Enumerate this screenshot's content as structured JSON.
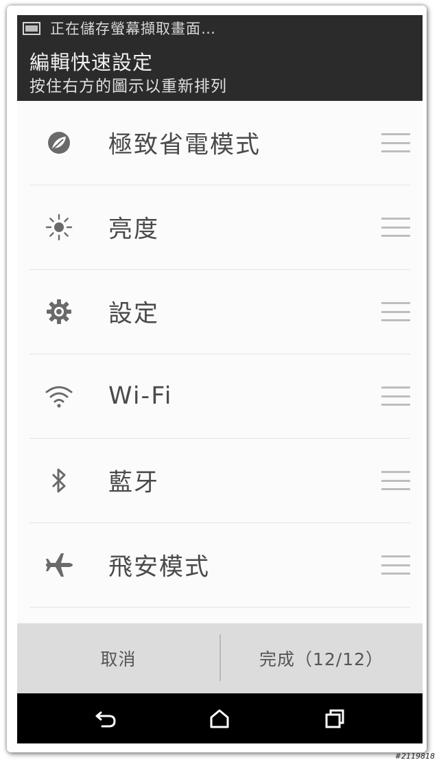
{
  "notification": {
    "text": "正在儲存螢幕擷取畫面…",
    "icon": "screenshot-icon"
  },
  "header": {
    "title": "編輯快速設定",
    "subtitle": "按住右方的圖示以重新排列"
  },
  "list": {
    "items": [
      {
        "label": "極致省電模式",
        "icon": "leaf-icon"
      },
      {
        "label": "亮度",
        "icon": "brightness-icon"
      },
      {
        "label": "設定",
        "icon": "gear-icon"
      },
      {
        "label": "Wi-Fi",
        "icon": "wifi-icon"
      },
      {
        "label": "藍牙",
        "icon": "bluetooth-icon"
      },
      {
        "label": "飛安模式",
        "icon": "airplane-icon"
      }
    ]
  },
  "actions": {
    "cancel_label": "取消",
    "done_label": "完成（12/12）"
  },
  "navbar": {
    "back_icon": "back-icon",
    "home_icon": "home-icon",
    "recents_icon": "recents-icon"
  },
  "watermark": "#2119818",
  "colors": {
    "header_bg": "#2b2b2b",
    "action_bar_bg": "#dcdcdc",
    "navbar_bg": "#000000",
    "icon_gray": "#6a6a6a"
  }
}
